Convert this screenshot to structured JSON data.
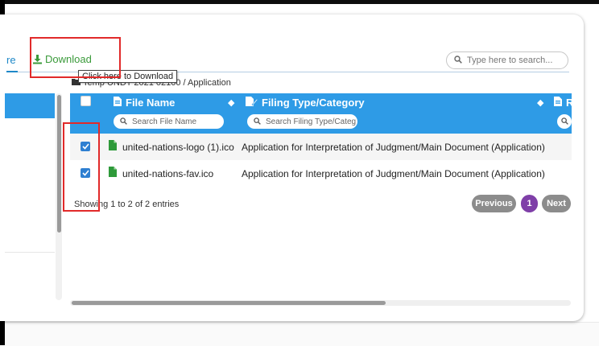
{
  "tabs": {
    "previous_fragment": "re",
    "download_label": "Download",
    "download_tooltip": "Click here to Download"
  },
  "search": {
    "placeholder": "Type here to search..."
  },
  "breadcrumb": {
    "path": "Temp UNDT 2021 02100 / Application"
  },
  "table": {
    "columns": [
      {
        "label": "File Name",
        "filter_placeholder": "Search File Name"
      },
      {
        "label": "Filing Type/Category",
        "filter_placeholder": "Search Filing Type/Category"
      },
      {
        "label": "R"
      }
    ],
    "rows": [
      {
        "checked": true,
        "file_name": "united-nations-logo (1).ico",
        "filing_type": "Application for Interpretation of Judgment/Main Document (Application)"
      },
      {
        "checked": true,
        "file_name": "united-nations-fav.ico",
        "filing_type": "Application for Interpretation of Judgment/Main Document (Application)"
      }
    ],
    "info": "Showing 1 to 2 of 2 entries"
  },
  "pagination": {
    "previous_label": "Previous",
    "current_page": "1",
    "next_label": "Next"
  },
  "colors": {
    "accent": "#2e9be6",
    "download": "#3a9a3a",
    "page_active": "#7f3fa8",
    "highlight": "#e12a2a"
  },
  "icons": {
    "download": "download-icon",
    "search": "search-icon",
    "folder": "folder-icon",
    "file": "file-icon",
    "filing": "edit-document-icon",
    "sort": "sort-icon"
  }
}
